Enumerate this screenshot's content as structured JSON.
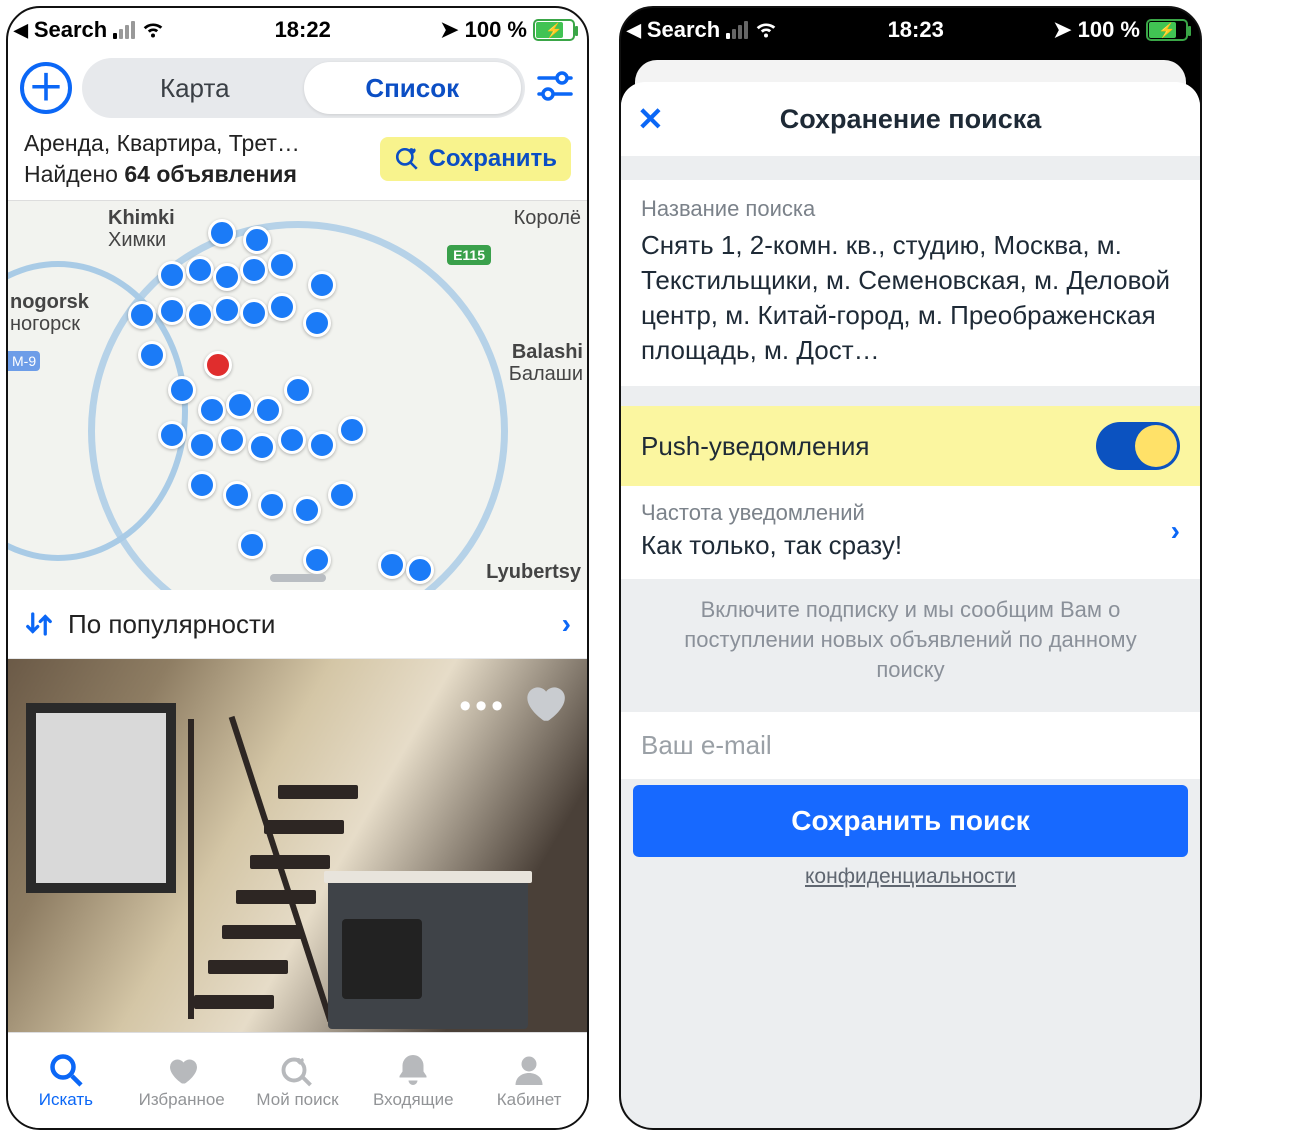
{
  "left": {
    "status": {
      "back": "Search",
      "time": "18:22",
      "battery": "100 %"
    },
    "segmented": {
      "map": "Карта",
      "list": "Список"
    },
    "filters_line": "Аренда, Квартира, Трет…",
    "found_prefix": "Найдено ",
    "found_bold": "64 объявления",
    "save_btn": "Сохранить",
    "map_labels": {
      "khimki_en": "Khimki",
      "khimki_ru": "Химки",
      "krasno_en": "nogorsk",
      "krasno_ru": "ногорск",
      "balashi_en": "Balashi",
      "balashi_ru": "Балаши",
      "lyub": "Lyubertsy",
      "korol": "Королё",
      "road": "E115",
      "mbadge": "М-9"
    },
    "sort": "По популярности",
    "tabs": {
      "search": "Искать",
      "fav": "Избранное",
      "mysearch": "Мой поиск",
      "inbox": "Входящие",
      "profile": "Кабинет"
    }
  },
  "right": {
    "status": {
      "back": "Search",
      "time": "18:23",
      "battery": "100 %"
    },
    "title": "Сохранение поиска",
    "name_label": "Название поиска",
    "name_value": "Снять 1, 2-комн. кв., студию, Москва, м. Текстильщики, м. Семеновская, м. Деловой центр, м. Китай-город, м. Преображенская площадь, м. Дост…",
    "push_label": "Push-уведомления",
    "freq_label": "Частота уведомлений",
    "freq_value": "Как только, так сразу!",
    "hint": "Включите подписку и мы сообщим Вам о поступлении новых объявлений по данному поиску",
    "email_ph": "Ваш e-mail",
    "cta": "Сохранить поиск",
    "privacy": "конфиденциальности"
  }
}
